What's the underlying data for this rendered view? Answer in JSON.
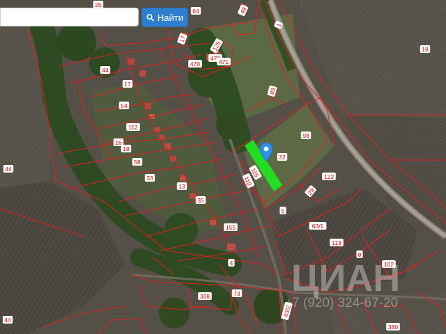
{
  "search": {
    "value": "",
    "button_label": "Найти"
  },
  "map": {
    "watermark": "ЦИАН",
    "watermark_phone": "+7 (920) 324-67-20",
    "selected_parcel": "116",
    "parcel_labels": [
      "25",
      "64",
      "49",
      "1",
      "17",
      "125",
      "470",
      "470",
      "471",
      "18",
      "44",
      "17",
      "89",
      "54",
      "112",
      "98",
      "16",
      "18",
      "22",
      "58",
      "116",
      "110",
      "122",
      "44",
      "33",
      "13",
      "29",
      "35",
      "5",
      "63/1",
      "155",
      "113",
      "8",
      "4",
      "102",
      "328",
      "73",
      "63/2",
      "380",
      "44"
    ],
    "colors": {
      "parcel_outline": "#e02020",
      "selected_parcel": "#22dd22",
      "pin": "#2f8ee8"
    }
  }
}
